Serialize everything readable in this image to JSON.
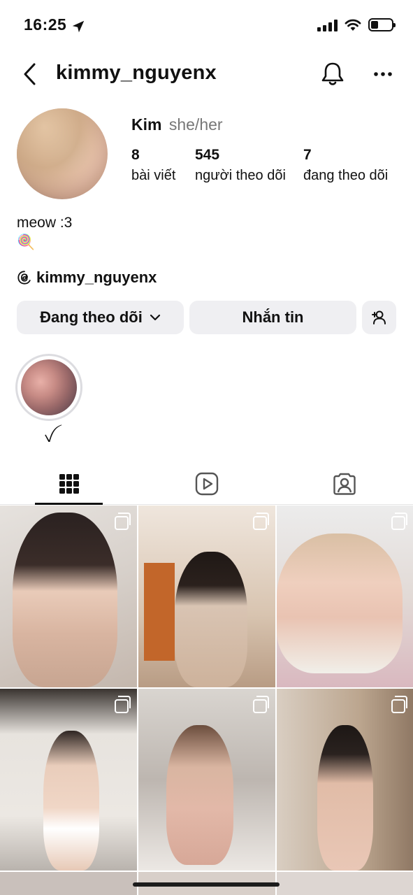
{
  "status_bar": {
    "time": "16:25",
    "battery_level": 0.35,
    "location_icon": "location-arrow-icon",
    "signal_icon": "cellular-signal-icon",
    "wifi_icon": "wifi-icon"
  },
  "header": {
    "username": "kimmy_nguyenx",
    "back_icon": "chevron-left-icon",
    "bell_icon": "bell-icon",
    "more_icon": "ellipsis-icon"
  },
  "profile": {
    "name": "Kim",
    "pronouns": "she/her",
    "stats": [
      {
        "value": "8",
        "label": "bài viết"
      },
      {
        "value": "545",
        "label": "người theo dõi"
      },
      {
        "value": "7",
        "label": "đang theo dõi"
      }
    ],
    "bio_line1": "meow :3",
    "bio_emoji": "🍭",
    "threads_handle": "kimmy_nguyenx"
  },
  "actions": {
    "follow_label": "Đang theo dõi",
    "message_label": "Nhắn tin",
    "suggest_icon": "add-person-icon"
  },
  "highlights": [
    {
      "label": "ꪜ"
    }
  ],
  "tabs": [
    {
      "name": "grid",
      "icon": "grid-icon",
      "active": true
    },
    {
      "name": "reels",
      "icon": "reels-icon",
      "active": false
    },
    {
      "name": "tagged",
      "icon": "tagged-icon",
      "active": false
    }
  ],
  "posts": [
    {
      "multi": true
    },
    {
      "multi": true
    },
    {
      "multi": true
    },
    {
      "multi": true
    },
    {
      "multi": true
    },
    {
      "multi": true
    }
  ],
  "colors": {
    "button_bg": "#efeff2",
    "text": "#111111",
    "secondary": "#777777"
  }
}
